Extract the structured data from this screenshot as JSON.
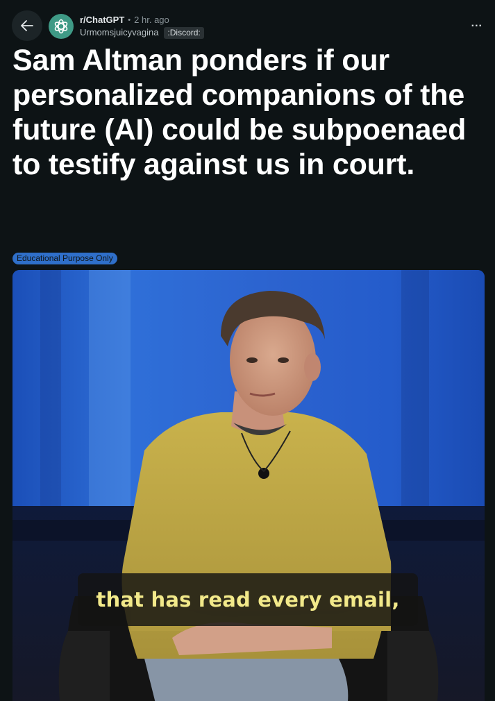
{
  "header": {
    "back_icon": "arrow-left-icon",
    "subreddit_icon": "openai-logo-icon",
    "subreddit": "r/ChatGPT",
    "separator": "•",
    "time_ago": "2 hr. ago",
    "author": "Urmomsjuicyvagina",
    "user_flair": ":Discord:",
    "more_icon": "more-options-icon",
    "more_label": "..."
  },
  "post": {
    "title": "Sam Altman ponders if our personalized companions of the future (AI) could be subpoenaed to testify against us in court.",
    "flair": "Educational Purpose Only",
    "video_caption": "that has read every email,"
  },
  "colors": {
    "background": "#0d1315",
    "flair_bg": "#2f6fc9",
    "avatar_bg": "#3f9a86",
    "caption_text": "#f2e98a"
  }
}
